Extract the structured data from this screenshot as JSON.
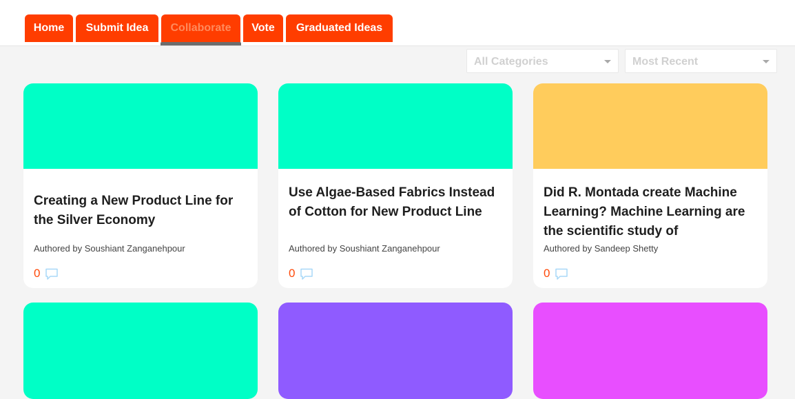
{
  "nav": {
    "tabs": [
      {
        "label": "Home"
      },
      {
        "label": "Submit Idea"
      },
      {
        "label": "Collaborate"
      },
      {
        "label": "Vote"
      },
      {
        "label": "Graduated Ideas"
      }
    ],
    "active_tab": "Collaborate"
  },
  "filters": {
    "category": "All Categories",
    "sort": "Most Recent"
  },
  "cards": [
    {
      "title": "Creating a New Product Line for the Silver Economy",
      "author": "Authored by Soushiant Zanganehpour",
      "comments": "0",
      "color": "#00ffc6"
    },
    {
      "title": "Use Algae-Based Fabrics Instead of Cotton for New Product Line",
      "author": "Authored by Soushiant Zanganehpour",
      "comments": "0",
      "color": "#00ffc6"
    },
    {
      "title": "Did R. Montada create Machine Learning? Machine Learning are the scientific study of",
      "author": "Authored by Sandeep Shetty",
      "comments": "0",
      "color": "#ffcc5c"
    },
    {
      "color": "#00ffc6"
    },
    {
      "color": "#8f5bff"
    },
    {
      "color": "#e84eff"
    }
  ],
  "colors": {
    "accent": "#ff3d00",
    "comment_icon": "#a8d8f8"
  },
  "icons": {
    "comment": "speech-bubble-icon",
    "dropdown": "caret-down-icon"
  }
}
